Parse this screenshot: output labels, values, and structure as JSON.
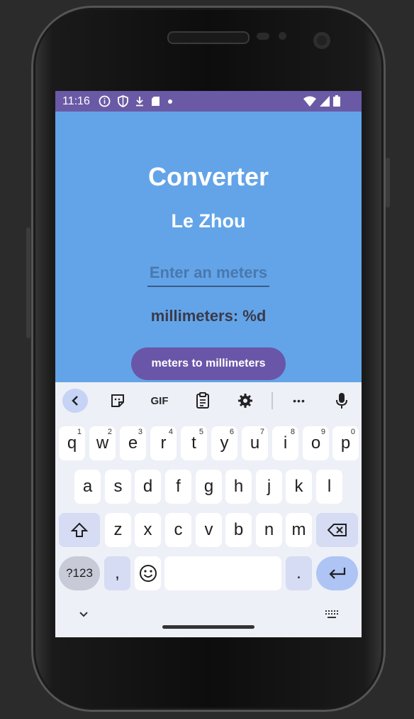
{
  "status_bar": {
    "time": "11:16",
    "icons": [
      "info-icon",
      "shield-icon",
      "download-icon",
      "sd-card-icon",
      "dot-icon"
    ],
    "right_icons": [
      "wifi-icon",
      "signal-icon",
      "battery-icon"
    ]
  },
  "app": {
    "title": "Converter",
    "subtitle": "Le Zhou",
    "input": {
      "placeholder": "Enter an meters",
      "value": ""
    },
    "result": "millimeters: %d",
    "button": "meters to millimeters"
  },
  "keyboard": {
    "toolbar": [
      "back-chevron-icon",
      "sticker-icon",
      "gif-icon",
      "clipboard-icon",
      "settings-icon",
      "more-icon",
      "mic-icon"
    ],
    "gif_label": "GIF",
    "more_label": "•••",
    "row1": [
      {
        "k": "q",
        "n": "1"
      },
      {
        "k": "w",
        "n": "2"
      },
      {
        "k": "e",
        "n": "3"
      },
      {
        "k": "r",
        "n": "4"
      },
      {
        "k": "t",
        "n": "5"
      },
      {
        "k": "y",
        "n": "6"
      },
      {
        "k": "u",
        "n": "7"
      },
      {
        "k": "i",
        "n": "8"
      },
      {
        "k": "o",
        "n": "9"
      },
      {
        "k": "p",
        "n": "0"
      }
    ],
    "row2": [
      "a",
      "s",
      "d",
      "f",
      "g",
      "h",
      "j",
      "k",
      "l"
    ],
    "row3": [
      "z",
      "x",
      "c",
      "v",
      "b",
      "n",
      "m"
    ],
    "sym_label": "?123",
    "comma": ",",
    "period": ".",
    "emoji_icon": "emoji-icon",
    "shift_icon": "shift-icon",
    "backspace_icon": "backspace-icon",
    "enter_icon": "enter-icon",
    "hide_icon": "chevron-down-icon",
    "keyboard_switch_icon": "keyboard-icon"
  },
  "colors": {
    "app_background": "#63a4e8",
    "status_bar": "#6a5aa5",
    "button": "#6a56a8"
  }
}
